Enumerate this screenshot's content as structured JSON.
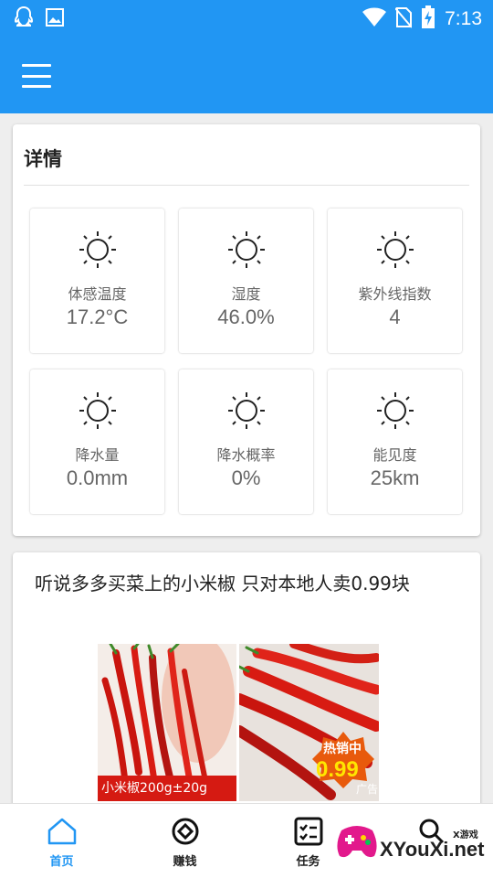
{
  "status_bar": {
    "time": "7:13",
    "icons": [
      "qq-icon",
      "image-icon",
      "wifi-icon",
      "no-sim-icon",
      "battery-charging-icon"
    ]
  },
  "app_bar": {
    "menu_icon": "hamburger-menu-icon",
    "color": "#2196f3"
  },
  "detail": {
    "title": "详情",
    "tiles": [
      {
        "icon": "sun-icon",
        "label": "体感温度",
        "value": "17.2°C"
      },
      {
        "icon": "sun-icon",
        "label": "湿度",
        "value": "46.0%"
      },
      {
        "icon": "sun-icon",
        "label": "紫外线指数",
        "value": "4"
      },
      {
        "icon": "sun-icon",
        "label": "降水量",
        "value": "0.0mm"
      },
      {
        "icon": "sun-icon",
        "label": "降水概率",
        "value": "0%"
      },
      {
        "icon": "sun-icon",
        "label": "能见度",
        "value": "25km"
      }
    ]
  },
  "news": {
    "title": "听说多多买菜上的小米椒 只对本地人卖0.99块",
    "image_caption": "小米椒200g±20g",
    "hot_label": "热销中",
    "hot_price": "0.99",
    "ad_label": "广告"
  },
  "bottom_nav": {
    "items": [
      {
        "label": "首页",
        "icon": "home-icon",
        "active": true
      },
      {
        "label": "赚钱",
        "icon": "coin-icon",
        "active": false
      },
      {
        "label": "任务",
        "icon": "task-list-icon",
        "active": false
      },
      {
        "label": "",
        "icon": "search-icon",
        "active": false
      }
    ],
    "active_color": "#2196f3"
  },
  "watermark": {
    "text": "XYouXi.net",
    "small_text": "X游戏"
  }
}
